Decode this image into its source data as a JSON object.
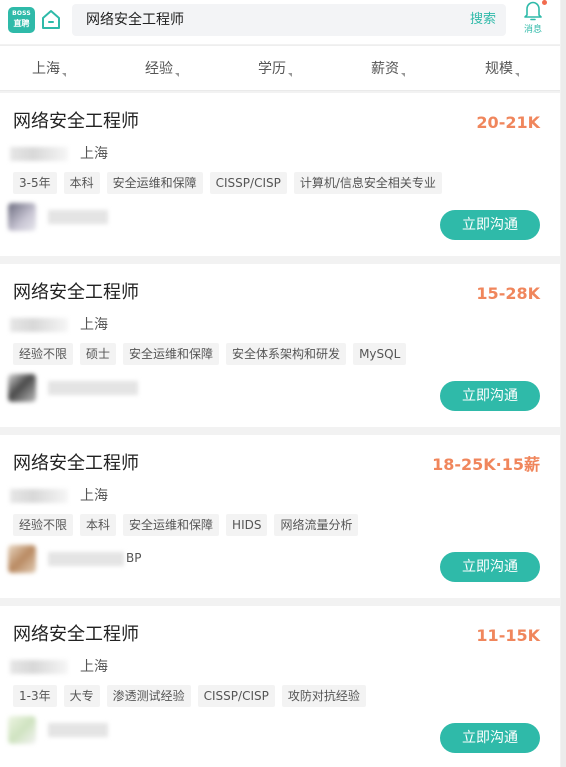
{
  "header": {
    "logo_line1": "BOSS",
    "logo_line2": "直聘",
    "search_query": "网络安全工程师",
    "search_button": "搜索",
    "message_label": "消息"
  },
  "filters": [
    {
      "label": "上海"
    },
    {
      "label": "经验"
    },
    {
      "label": "学历"
    },
    {
      "label": "薪资"
    },
    {
      "label": "规模"
    }
  ],
  "jobs": [
    {
      "title": "网络安全工程师",
      "salary": "20-21K",
      "city": "上海",
      "tags": [
        "3-5年",
        "本科",
        "安全运维和保障",
        "CISSP/CISP",
        "计算机/信息安全相关专业"
      ],
      "recruiter_suffix": "",
      "chat_button": "立即沟通"
    },
    {
      "title": "网络安全工程师",
      "salary": "15-28K",
      "city": "上海",
      "tags": [
        "经验不限",
        "硕士",
        "安全运维和保障",
        "安全体系架构和研发",
        "MySQL"
      ],
      "recruiter_suffix": "",
      "chat_button": "立即沟通"
    },
    {
      "title": "网络安全工程师",
      "salary": "18-25K·15薪",
      "city": "上海",
      "tags": [
        "经验不限",
        "本科",
        "安全运维和保障",
        "HIDS",
        "网络流量分析"
      ],
      "recruiter_suffix": "BP",
      "chat_button": "立即沟通"
    },
    {
      "title": "网络安全工程师",
      "salary": "11-15K",
      "city": "上海",
      "tags": [
        "1-3年",
        "大专",
        "渗透测试经验",
        "CISSP/CISP",
        "攻防对抗经验"
      ],
      "recruiter_suffix": "",
      "chat_button": "立即沟通"
    }
  ],
  "colors": {
    "brand": "#2fbaa9",
    "salary": "#f0865c",
    "tag_bg": "#f3f3f3"
  }
}
